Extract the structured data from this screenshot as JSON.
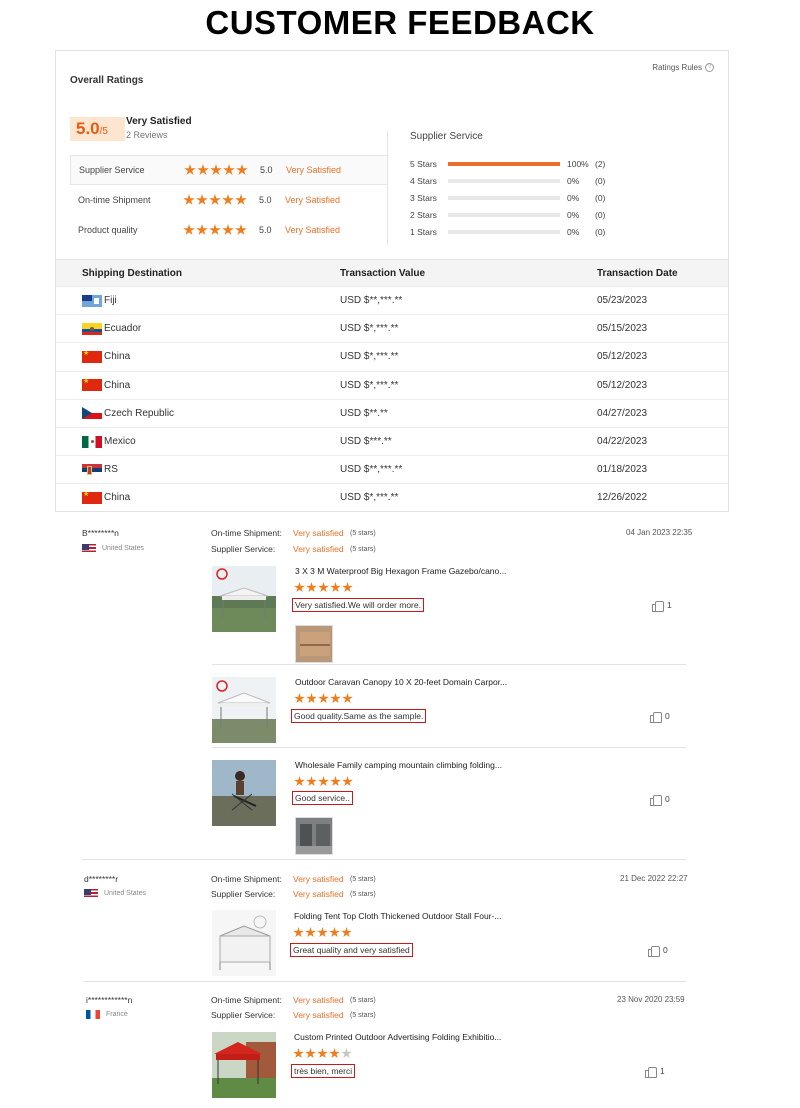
{
  "page_title": "CUSTOMER FEEDBACK",
  "overall": {
    "label": "Overall Ratings",
    "rules_label": "Ratings Rules",
    "score": "5.0",
    "score_den": "/5",
    "satisfaction": "Very Satisfied",
    "reviews": "2 Reviews",
    "metrics": [
      {
        "label": "Supplier Service",
        "stars": 5,
        "value": "5.0",
        "text": "Very Satisfied"
      },
      {
        "label": "On-time Shipment",
        "stars": 5,
        "value": "5.0",
        "text": "Very Satisfied"
      },
      {
        "label": "Product quality",
        "stars": 5,
        "value": "5.0",
        "text": "Very Satisfied"
      }
    ]
  },
  "supplier_service": {
    "title": "Supplier Service",
    "rows": [
      {
        "label": "5  Stars",
        "fraction": 1.0,
        "percent": "100%",
        "count": "(2)"
      },
      {
        "label": "4  Stars",
        "fraction": 0,
        "percent": "0%",
        "count": "(0)"
      },
      {
        "label": "3  Stars",
        "fraction": 0,
        "percent": "0%",
        "count": "(0)"
      },
      {
        "label": "2  Stars",
        "fraction": 0,
        "percent": "0%",
        "count": "(0)"
      },
      {
        "label": "1  Stars",
        "fraction": 0,
        "percent": "0%",
        "count": "(0)"
      }
    ]
  },
  "transactions": {
    "headers": [
      "Shipping Destination",
      "Transaction Value",
      "Transaction Date"
    ],
    "rows": [
      {
        "flag": "fiji",
        "destination": "Fiji",
        "value": "USD $**,***.**",
        "date": "05/23/2023"
      },
      {
        "flag": "ecuador",
        "destination": "Ecuador",
        "value": "USD $*,***.**",
        "date": "05/15/2023"
      },
      {
        "flag": "china",
        "destination": "China",
        "value": "USD $*,***.**",
        "date": "05/12/2023"
      },
      {
        "flag": "china",
        "destination": "China",
        "value": "USD $*,***.**",
        "date": "05/12/2023"
      },
      {
        "flag": "czech",
        "destination": "Czech Republic",
        "value": "USD $**.**",
        "date": "04/27/2023"
      },
      {
        "flag": "mexico",
        "destination": "Mexico",
        "value": "USD $***.**",
        "date": "04/22/2023"
      },
      {
        "flag": "rs",
        "destination": "RS",
        "value": "USD $**,***.**",
        "date": "01/18/2023"
      },
      {
        "flag": "china",
        "destination": "China",
        "value": "USD $*,***.**",
        "date": "12/26/2022"
      }
    ]
  },
  "review_labels": {
    "shipment": "On-time Shipment:",
    "service": "Supplier Service:",
    "very_satisfied": "Very satisfied",
    "five_stars": "(5 stars)"
  },
  "reviews": [
    {
      "user": "B********n",
      "country": "United States",
      "flag": "us",
      "date": "04 Jan 2023 22:35",
      "products": [
        {
          "title": "3 X 3 M Waterproof Big Hexagon Frame Gazebo/cano...",
          "stars": 5,
          "comment": "Very satisfied.We will order more.",
          "likes": "1",
          "has_photo": true
        },
        {
          "title": "Outdoor Caravan Canopy 10 X 20-feet Domain Carpor...",
          "stars": 5,
          "comment": "Good quality.Same as the sample.",
          "likes": "0",
          "has_photo": false
        },
        {
          "title": "Wholesale Family camping mountain climbing folding...",
          "stars": 5,
          "comment": "Good service..",
          "likes": "0",
          "has_photo": true
        }
      ]
    },
    {
      "user": "d********r",
      "country": "United States",
      "flag": "us",
      "date": "21 Dec 2022 22:27",
      "products": [
        {
          "title": "Folding Tent Top Cloth Thickened Outdoor Stall Four-...",
          "stars": 5,
          "comment": "Great quality and very satisfied",
          "likes": "0",
          "has_photo": false
        }
      ]
    },
    {
      "user": "i************n",
      "country": "France",
      "flag": "fr",
      "date": "23 Nov 2020 23:59",
      "products": [
        {
          "title": "Custom Printed Outdoor Advertising Folding Exhibitio...",
          "stars": 4,
          "comment": "très bien, merci",
          "likes": "1",
          "has_photo": false
        }
      ]
    }
  ],
  "colors": {
    "accent": "#e8702a",
    "star": "#f07d1c",
    "score_bg": "#fde6cf",
    "comment_border": "#c81a1a"
  }
}
